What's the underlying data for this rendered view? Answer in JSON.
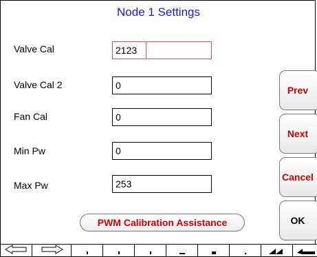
{
  "title": "Node 1 Settings",
  "fields": [
    {
      "label": "Valve Cal",
      "value": "2123"
    },
    {
      "label": "Valve Cal 2",
      "value": "0"
    },
    {
      "label": "Fan Cal",
      "value": "0"
    },
    {
      "label": "Min Pw",
      "value": "0"
    },
    {
      "label": "Max Pw",
      "value": "253"
    }
  ],
  "buttons": {
    "prev": "Prev",
    "next": "Next",
    "cancel": "Cancel",
    "ok": "OK",
    "pwm": "PWM Calibration Assistance"
  },
  "toolbar_icons": [
    "arrow-left-icon",
    "arrow-right-icon",
    "dot-icon",
    "dot-icon",
    "dot-icon",
    "dot-icon",
    "dot-icon",
    "dot-icon",
    "double-left-icon",
    "back-icon"
  ],
  "colors": {
    "title": "#1a18d6",
    "button_text": "#d40000",
    "active_field_border": "#e05050"
  }
}
